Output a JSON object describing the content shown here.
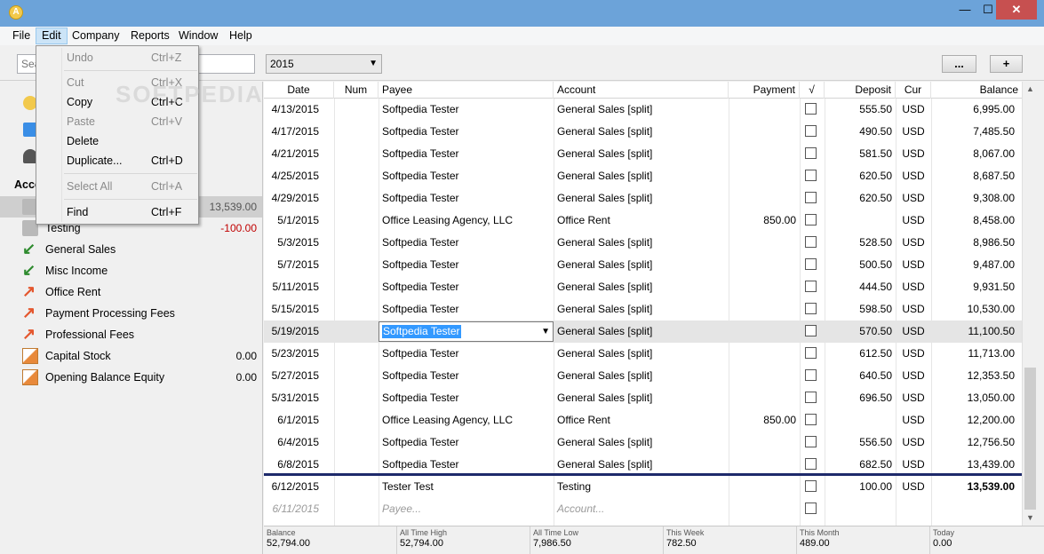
{
  "titlebar": {
    "app_icon": "A",
    "min": "—",
    "max": "☐",
    "close": "✕"
  },
  "menubar": {
    "items": [
      "File",
      "Edit",
      "Company",
      "Reports",
      "Window",
      "Help"
    ]
  },
  "toolbar": {
    "search_placeholder": "Search",
    "year": "2015",
    "more_label": "...",
    "add_label": "+"
  },
  "edit_menu": {
    "items": [
      {
        "label": "Undo",
        "shortcut": "Ctrl+Z",
        "enabled": false
      },
      {
        "label": "Cut",
        "shortcut": "Ctrl+X",
        "enabled": false
      },
      {
        "label": "Copy",
        "shortcut": "Ctrl+C",
        "enabled": true
      },
      {
        "label": "Paste",
        "shortcut": "Ctrl+V",
        "enabled": false
      },
      {
        "label": "Delete",
        "shortcut": "",
        "enabled": true
      },
      {
        "label": "Duplicate...",
        "shortcut": "Ctrl+D",
        "enabled": true
      },
      {
        "label": "Select All",
        "shortcut": "Ctrl+A",
        "enabled": false
      },
      {
        "label": "Find",
        "shortcut": "Ctrl+F",
        "enabled": true
      }
    ]
  },
  "sidebar": {
    "accounts_header": "Acco",
    "accounts": [
      {
        "label": "",
        "amount": "13,539.00",
        "icon": "bank-icon",
        "selected": true
      },
      {
        "label": "Testing",
        "amount": "-100.00",
        "icon": "bank-icon"
      },
      {
        "label": "General Sales",
        "amount": "",
        "icon": "income-arrow-icon"
      },
      {
        "label": "Misc Income",
        "amount": "",
        "icon": "income-arrow-icon"
      },
      {
        "label": "Office Rent",
        "amount": "",
        "icon": "expense-arrow-icon"
      },
      {
        "label": "Payment Processing Fees",
        "amount": "",
        "icon": "expense-arrow-icon"
      },
      {
        "label": "Professional Fees",
        "amount": "",
        "icon": "expense-arrow-icon"
      },
      {
        "label": "Capital Stock",
        "amount": "0.00",
        "icon": "equity-icon"
      },
      {
        "label": "Opening Balance Equity",
        "amount": "0.00",
        "icon": "equity-icon"
      }
    ],
    "negative_color": "#c00000"
  },
  "register": {
    "columns": [
      "Date",
      "Num",
      "Payee",
      "Account",
      "Payment",
      "√",
      "Deposit",
      "Cur",
      "Balance"
    ],
    "rows": [
      {
        "date": "4/13/2015",
        "payee": "Softpedia Tester",
        "account": "General Sales [split]",
        "payment": "",
        "deposit": "555.50",
        "cur": "USD",
        "balance": "6,995.00"
      },
      {
        "date": "4/17/2015",
        "payee": "Softpedia Tester",
        "account": "General Sales [split]",
        "payment": "",
        "deposit": "490.50",
        "cur": "USD",
        "balance": "7,485.50"
      },
      {
        "date": "4/21/2015",
        "payee": "Softpedia Tester",
        "account": "General Sales [split]",
        "payment": "",
        "deposit": "581.50",
        "cur": "USD",
        "balance": "8,067.00"
      },
      {
        "date": "4/25/2015",
        "payee": "Softpedia Tester",
        "account": "General Sales [split]",
        "payment": "",
        "deposit": "620.50",
        "cur": "USD",
        "balance": "8,687.50"
      },
      {
        "date": "4/29/2015",
        "payee": "Softpedia Tester",
        "account": "General Sales [split]",
        "payment": "",
        "deposit": "620.50",
        "cur": "USD",
        "balance": "9,308.00"
      },
      {
        "date": "5/1/2015",
        "payee": "Office Leasing Agency, LLC",
        "account": "Office Rent",
        "payment": "850.00",
        "deposit": "",
        "cur": "USD",
        "balance": "8,458.00"
      },
      {
        "date": "5/3/2015",
        "payee": "Softpedia Tester",
        "account": "General Sales [split]",
        "payment": "",
        "deposit": "528.50",
        "cur": "USD",
        "balance": "8,986.50"
      },
      {
        "date": "5/7/2015",
        "payee": "Softpedia Tester",
        "account": "General Sales [split]",
        "payment": "",
        "deposit": "500.50",
        "cur": "USD",
        "balance": "9,487.00"
      },
      {
        "date": "5/11/2015",
        "payee": "Softpedia Tester",
        "account": "General Sales [split]",
        "payment": "",
        "deposit": "444.50",
        "cur": "USD",
        "balance": "9,931.50"
      },
      {
        "date": "5/15/2015",
        "payee": "Softpedia Tester",
        "account": "General Sales [split]",
        "payment": "",
        "deposit": "598.50",
        "cur": "USD",
        "balance": "10,530.00"
      },
      {
        "date": "5/19/2015",
        "payee": "Softpedia Tester",
        "account": "General Sales [split]",
        "payment": "",
        "deposit": "570.50",
        "cur": "USD",
        "balance": "11,100.50",
        "editing": true
      },
      {
        "date": "5/23/2015",
        "payee": "Softpedia Tester",
        "account": "General Sales [split]",
        "payment": "",
        "deposit": "612.50",
        "cur": "USD",
        "balance": "11,713.00"
      },
      {
        "date": "5/27/2015",
        "payee": "Softpedia Tester",
        "account": "General Sales [split]",
        "payment": "",
        "deposit": "640.50",
        "cur": "USD",
        "balance": "12,353.50"
      },
      {
        "date": "5/31/2015",
        "payee": "Softpedia Tester",
        "account": "General Sales [split]",
        "payment": "",
        "deposit": "696.50",
        "cur": "USD",
        "balance": "13,050.00"
      },
      {
        "date": "6/1/2015",
        "payee": "Office Leasing Agency, LLC",
        "account": "Office Rent",
        "payment": "850.00",
        "deposit": "",
        "cur": "USD",
        "balance": "12,200.00"
      },
      {
        "date": "6/4/2015",
        "payee": "Softpedia Tester",
        "account": "General Sales [split]",
        "payment": "",
        "deposit": "556.50",
        "cur": "USD",
        "balance": "12,756.50"
      },
      {
        "date": "6/8/2015",
        "payee": "Softpedia Tester",
        "account": "General Sales [split]",
        "payment": "",
        "deposit": "682.50",
        "cur": "USD",
        "balance": "13,439.00"
      },
      {
        "date": "6/12/2015",
        "payee": "Tester Test",
        "account": "Testing",
        "payment": "",
        "deposit": "100.00",
        "cur": "USD",
        "balance": "13,539.00",
        "bold_balance": true
      }
    ],
    "new_row": {
      "date": "6/11/2015",
      "payee": "Payee...",
      "account": "Account..."
    }
  },
  "summary": [
    {
      "label": "Balance",
      "value": "52,794.00"
    },
    {
      "label": "All Time High",
      "value": "52,794.00"
    },
    {
      "label": "All Time Low",
      "value": "7,986.50"
    },
    {
      "label": "This Week",
      "value": "782.50"
    },
    {
      "label": "This Month",
      "value": "489.00"
    },
    {
      "label": "Today",
      "value": "0.00"
    }
  ],
  "watermark": "SOFTPEDIA"
}
